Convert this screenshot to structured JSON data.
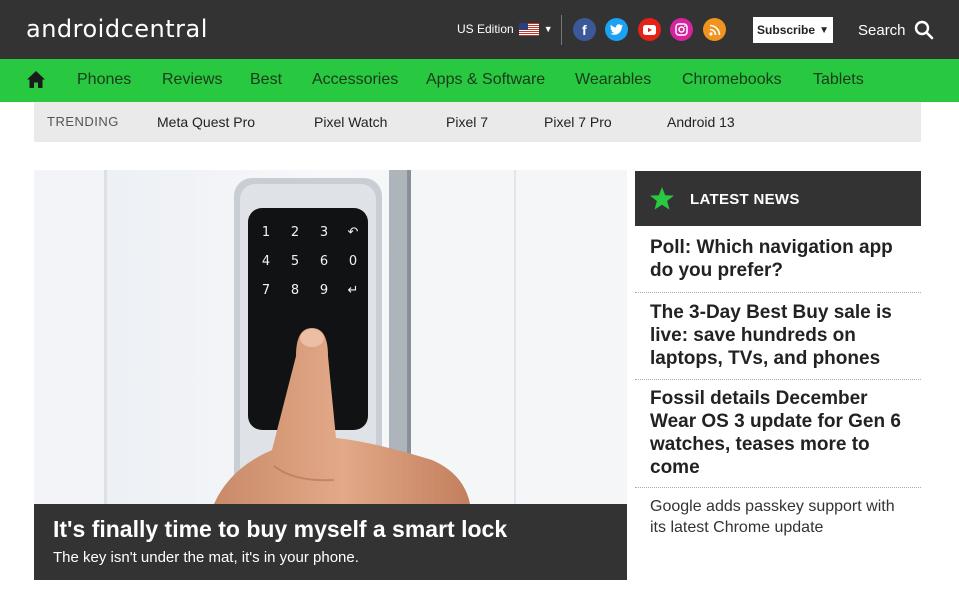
{
  "header": {
    "logo": "androidcentral",
    "edition": "US Edition",
    "subscribe": "Subscribe",
    "search": "Search"
  },
  "social_icons": [
    "facebook-icon",
    "twitter-icon",
    "youtube-icon",
    "instagram-icon",
    "rss-icon"
  ],
  "colors": {
    "header_bg": "#333333",
    "nav_bg": "#28c840",
    "facebook": "#3b5998",
    "twitter": "#1da1f2",
    "youtube": "#e62117",
    "instagram": "#d6249f",
    "rss": "#f0931f",
    "star": "#28c840"
  },
  "nav": {
    "items": [
      "Phones",
      "Reviews",
      "Best",
      "Accessories",
      "Apps & Software",
      "Wearables",
      "Chromebooks",
      "Tablets"
    ]
  },
  "trending": {
    "label": "TRENDING",
    "items": [
      "Meta Quest Pro",
      "Pixel Watch",
      "Pixel 7",
      "Pixel 7 Pro",
      "Android 13"
    ]
  },
  "hero": {
    "title": "It's finally time to buy myself a smart lock",
    "subtitle": "The key isn't under the mat, it's in your phone.",
    "keypad": [
      "1",
      "2",
      "3",
      "↶",
      "4",
      "5",
      "6",
      "0",
      "7",
      "8",
      "9",
      "↵"
    ]
  },
  "latest_news": {
    "heading": "LATEST NEWS",
    "items": [
      "Poll: Which navigation app do you prefer?",
      "The 3-Day Best Buy sale is live: save hundreds on laptops, TVs, and phones",
      "Fossil details December Wear OS 3 update for Gen 6 watches, teases more to come",
      "Google adds passkey support with its latest Chrome update"
    ]
  }
}
